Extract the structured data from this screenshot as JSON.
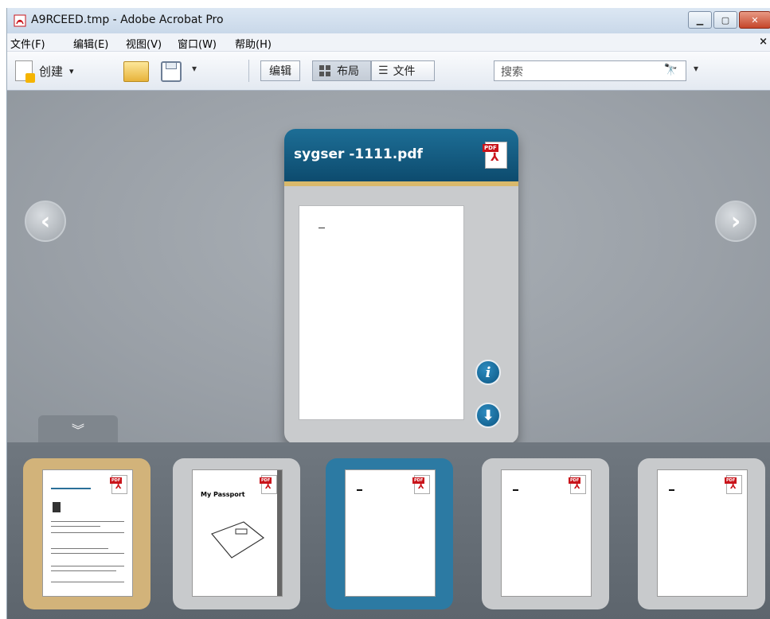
{
  "window": {
    "title": "A9RCEED.tmp - Adobe Acrobat Pro"
  },
  "menu": [
    "文件(F)",
    "编辑(E)",
    "视图(V)",
    "窗口(W)",
    "帮助(H)"
  ],
  "menu_close": "×",
  "toolbar": {
    "create_label": "创建",
    "edit_label": "编辑",
    "layout_label": "布局",
    "files_label": "文件",
    "search_placeholder": "搜索"
  },
  "card": {
    "filename": "sygser -1111.pdf"
  },
  "pdf_tag": "PDF",
  "thumbnails": [
    {
      "state": "gold"
    },
    {
      "state": "default",
      "title": "My Passport"
    },
    {
      "state": "selected"
    },
    {
      "state": "default"
    },
    {
      "state": "default"
    }
  ]
}
